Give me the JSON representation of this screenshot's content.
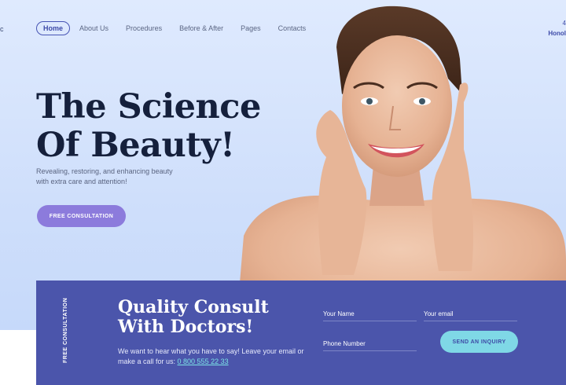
{
  "header": {
    "logo_fragment": "ic",
    "nav": [
      {
        "label": "Home",
        "active": true
      },
      {
        "label": "About Us"
      },
      {
        "label": "Procedures"
      },
      {
        "label": "Before & After"
      },
      {
        "label": "Pages"
      },
      {
        "label": "Contacts"
      }
    ],
    "contact_fragment": {
      "line1": "4",
      "line2": "Honol"
    }
  },
  "hero": {
    "headline_line1": "The Science",
    "headline_line2": "Of Beauty!",
    "subtext": "Revealing, restoring, and enhancing beauty with extra care and attention!",
    "cta_label": "FREE CONSULTATION",
    "image": "smiling-woman-portrait"
  },
  "consult": {
    "vertical_label": "FREE CONSULTATION",
    "title_line1": "Quality Consult",
    "title_line2": "With Doctors!",
    "text": "We want to hear what you have to say! Leave your email or make a call for us: ",
    "phone": "0 800 555 22 33",
    "fields": {
      "name_placeholder": "Your Name",
      "email_placeholder": "Your email",
      "phone_placeholder": "Phone Number"
    },
    "send_label": "SEND AN INQUIRY"
  },
  "colors": {
    "hero_bg": "#d4e3fc",
    "accent_purple": "#8c7bdc",
    "panel": "#4b55ab",
    "accent_cyan": "#7fd8e6",
    "headline": "#15203c"
  }
}
